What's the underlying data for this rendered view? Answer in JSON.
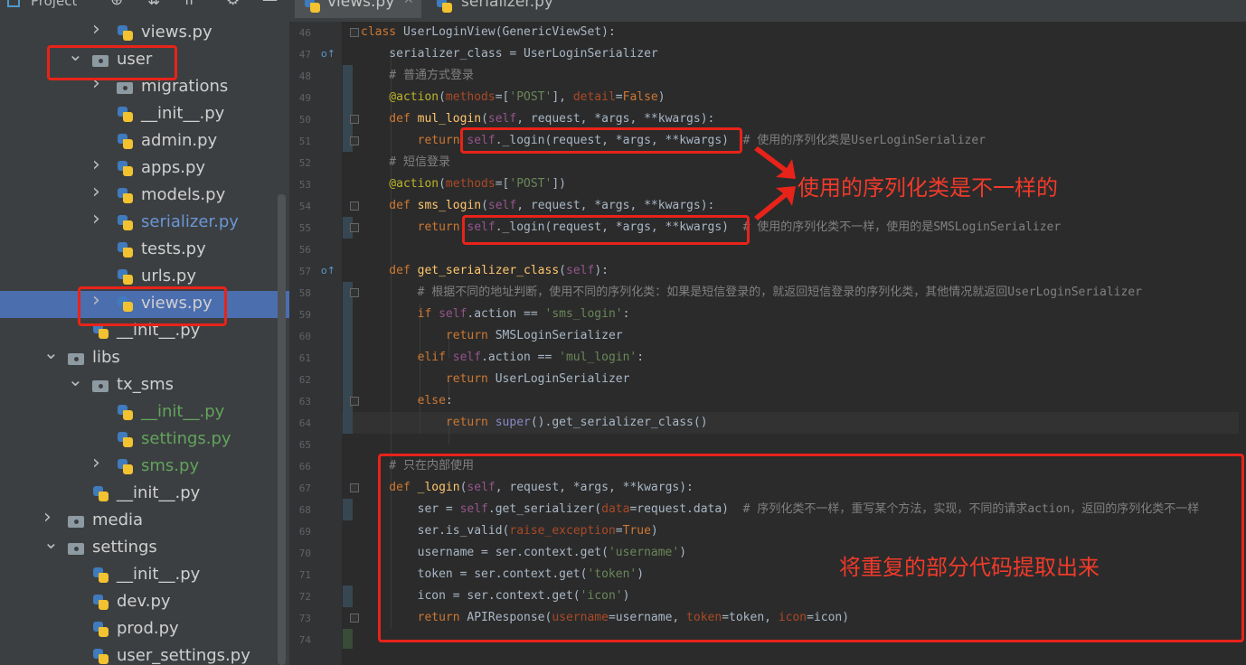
{
  "project_panel": {
    "title": "Project",
    "tree": [
      {
        "label": "views.py",
        "type": "py",
        "arrow": "right",
        "style": "normal"
      },
      {
        "label": "user",
        "type": "folder",
        "arrow": "down",
        "style": "normal"
      },
      {
        "label": "migrations",
        "type": "folder",
        "arrow": "right",
        "style": "normal"
      },
      {
        "label": "__init__.py",
        "type": "py",
        "arrow": "",
        "style": "normal"
      },
      {
        "label": "admin.py",
        "type": "py",
        "arrow": "",
        "style": "normal"
      },
      {
        "label": "apps.py",
        "type": "py",
        "arrow": "right",
        "style": "normal"
      },
      {
        "label": "models.py",
        "type": "py",
        "arrow": "right",
        "style": "normal"
      },
      {
        "label": "serializer.py",
        "type": "py",
        "arrow": "right",
        "style": "blue"
      },
      {
        "label": "tests.py",
        "type": "py",
        "arrow": "",
        "style": "normal"
      },
      {
        "label": "urls.py",
        "type": "py",
        "arrow": "",
        "style": "normal"
      },
      {
        "label": "views.py",
        "type": "py",
        "arrow": "right",
        "style": "selected"
      },
      {
        "label": "__init__.py",
        "type": "py",
        "arrow": "",
        "style": "normal"
      },
      {
        "label": "libs",
        "type": "folder",
        "arrow": "down",
        "style": "normal"
      },
      {
        "label": "tx_sms",
        "type": "folder",
        "arrow": "down",
        "style": "normal"
      },
      {
        "label": "__init__.py",
        "type": "py",
        "arrow": "",
        "style": "green"
      },
      {
        "label": "settings.py",
        "type": "py",
        "arrow": "",
        "style": "green"
      },
      {
        "label": "sms.py",
        "type": "py",
        "arrow": "right",
        "style": "green"
      },
      {
        "label": "__init__.py",
        "type": "py",
        "arrow": "",
        "style": "normal"
      },
      {
        "label": "media",
        "type": "folder",
        "arrow": "right",
        "style": "normal"
      },
      {
        "label": "settings",
        "type": "folder",
        "arrow": "down",
        "style": "normal"
      },
      {
        "label": "__init__.py",
        "type": "py",
        "arrow": "",
        "style": "normal"
      },
      {
        "label": "dev.py",
        "type": "py",
        "arrow": "",
        "style": "normal"
      },
      {
        "label": "prod.py",
        "type": "py",
        "arrow": "",
        "style": "normal"
      },
      {
        "label": "user_settings.py",
        "type": "py",
        "arrow": "",
        "style": "normal"
      }
    ]
  },
  "tabs": [
    {
      "label": "views.py",
      "active": true
    },
    {
      "label": "serializer.py",
      "active": false
    }
  ],
  "editor": {
    "current_line": 64,
    "lines": [
      {
        "n": 46,
        "tokens": [
          [
            "kw",
            "class "
          ],
          [
            "",
            "UserLoginView(GenericViewSet):"
          ]
        ]
      },
      {
        "n": 47,
        "tokens": [
          [
            "",
            "    serializer_class = UserLoginSerializer"
          ]
        ]
      },
      {
        "n": 48,
        "tokens": [
          [
            "cm",
            "    # 普通方式登录"
          ]
        ]
      },
      {
        "n": 49,
        "tokens": [
          [
            "deco",
            "    @action"
          ],
          [
            "",
            "("
          ],
          [
            "param",
            "methods"
          ],
          [
            "",
            "=["
          ],
          [
            "str",
            "'POST'"
          ],
          [
            "",
            "], "
          ],
          [
            "param",
            "detail"
          ],
          [
            "",
            "="
          ],
          [
            "kw",
            "False"
          ],
          [
            "",
            ")"
          ]
        ]
      },
      {
        "n": 50,
        "tokens": [
          [
            "kw",
            "    def "
          ],
          [
            "fn",
            "mul_login"
          ],
          [
            "",
            "("
          ],
          [
            "self",
            "self"
          ],
          [
            "",
            ", request, *args, **kwargs):"
          ]
        ]
      },
      {
        "n": 51,
        "tokens": [
          [
            "kw",
            "        return "
          ],
          [
            "self",
            "self"
          ],
          [
            "",
            "._login(request, *args, **kwargs)  "
          ],
          [
            "cm",
            "# 使用的序列化类是UserLoginSerializer"
          ]
        ]
      },
      {
        "n": 52,
        "tokens": [
          [
            "cm",
            "    # 短信登录"
          ]
        ]
      },
      {
        "n": 53,
        "tokens": [
          [
            "deco",
            "    @action"
          ],
          [
            "",
            "("
          ],
          [
            "param",
            "methods"
          ],
          [
            "",
            "=["
          ],
          [
            "str",
            "'POST'"
          ],
          [
            "",
            "])"
          ]
        ]
      },
      {
        "n": 54,
        "tokens": [
          [
            "kw",
            "    def "
          ],
          [
            "fn",
            "sms_login"
          ],
          [
            "",
            "("
          ],
          [
            "self",
            "self"
          ],
          [
            "",
            ", request, *args, **kwargs):"
          ]
        ]
      },
      {
        "n": 55,
        "tokens": [
          [
            "kw",
            "        return "
          ],
          [
            "self",
            "self"
          ],
          [
            "",
            "._login(request, *args, **kwargs)  "
          ],
          [
            "cm",
            "# 使用的序列化类不一样，使用的是SMSLoginSerializer"
          ]
        ]
      },
      {
        "n": 56,
        "tokens": []
      },
      {
        "n": 57,
        "tokens": [
          [
            "kw",
            "    def "
          ],
          [
            "fn",
            "get_serializer_class"
          ],
          [
            "",
            "("
          ],
          [
            "self",
            "self"
          ],
          [
            "",
            "):"
          ]
        ]
      },
      {
        "n": 58,
        "tokens": [
          [
            "cm",
            "        # 根据不同的地址判断，使用不同的序列化类：如果是短信登录的，就返回短信登录的序列化类，其他情况就返回UserLoginSerializer"
          ]
        ]
      },
      {
        "n": 59,
        "tokens": [
          [
            "kw",
            "        if "
          ],
          [
            "self",
            "self"
          ],
          [
            "",
            ".action == "
          ],
          [
            "str",
            "'sms_login'"
          ],
          [
            "",
            ":"
          ]
        ]
      },
      {
        "n": 60,
        "tokens": [
          [
            "kw",
            "            return "
          ],
          [
            "",
            "SMSLoginSerializer"
          ]
        ]
      },
      {
        "n": 61,
        "tokens": [
          [
            "kw",
            "        elif "
          ],
          [
            "self",
            "self"
          ],
          [
            "",
            ".action == "
          ],
          [
            "str",
            "'mul_login'"
          ],
          [
            "",
            ":"
          ]
        ]
      },
      {
        "n": 62,
        "tokens": [
          [
            "kw",
            "            return "
          ],
          [
            "",
            "UserLoginSerializer"
          ]
        ]
      },
      {
        "n": 63,
        "tokens": [
          [
            "kw",
            "        else"
          ],
          [
            "",
            ":"
          ]
        ]
      },
      {
        "n": 64,
        "tokens": [
          [
            "kw",
            "            return "
          ],
          [
            "builtin",
            "super"
          ],
          [
            "",
            "().get_serializer_class()"
          ]
        ]
      },
      {
        "n": 65,
        "tokens": []
      },
      {
        "n": 66,
        "tokens": [
          [
            "cm",
            "    # 只在内部使用"
          ]
        ]
      },
      {
        "n": 67,
        "tokens": [
          [
            "kw",
            "    def "
          ],
          [
            "fn",
            "_login"
          ],
          [
            "",
            "("
          ],
          [
            "self",
            "self"
          ],
          [
            "",
            ", request, *args, **kwargs):"
          ]
        ]
      },
      {
        "n": 68,
        "tokens": [
          [
            "",
            "        ser = "
          ],
          [
            "self",
            "self"
          ],
          [
            "",
            ".get_serializer("
          ],
          [
            "param",
            "data"
          ],
          [
            "",
            "=request.data)  "
          ],
          [
            "cm",
            "# 序列化类不一样，重写某个方法，实现，不同的请求action，返回的序列化类不一样"
          ]
        ]
      },
      {
        "n": 69,
        "tokens": [
          [
            "",
            "        ser.is_valid("
          ],
          [
            "param",
            "raise_exception"
          ],
          [
            "",
            "="
          ],
          [
            "kw",
            "True"
          ],
          [
            "",
            ")"
          ]
        ]
      },
      {
        "n": 70,
        "tokens": [
          [
            "",
            "        username = ser.context.get("
          ],
          [
            "str",
            "'username'"
          ],
          [
            "",
            ")"
          ]
        ]
      },
      {
        "n": 71,
        "tokens": [
          [
            "",
            "        token = ser.context.get("
          ],
          [
            "str",
            "'token'"
          ],
          [
            "",
            ")"
          ]
        ]
      },
      {
        "n": 72,
        "tokens": [
          [
            "",
            "        icon = ser.context.get("
          ],
          [
            "str",
            "'icon'"
          ],
          [
            "",
            ")"
          ]
        ]
      },
      {
        "n": 73,
        "tokens": [
          [
            "kw",
            "        return "
          ],
          [
            "",
            "APIResponse("
          ],
          [
            "param",
            "username"
          ],
          [
            "",
            "=username, "
          ],
          [
            "param",
            "token"
          ],
          [
            "",
            "=token, "
          ],
          [
            "param",
            "icon"
          ],
          [
            "",
            "=icon)"
          ]
        ]
      },
      {
        "n": 74,
        "tokens": []
      }
    ]
  },
  "annotations": {
    "different_serializer": "使用的序列化类是不一样的",
    "extract_common": "将重复的部分代码提取出来"
  },
  "colors": {
    "annotation_red": "#e8231a",
    "selection": "#4b6eaf",
    "editor_bg": "#2b2b2b",
    "sidebar_bg": "#3c3f41"
  }
}
